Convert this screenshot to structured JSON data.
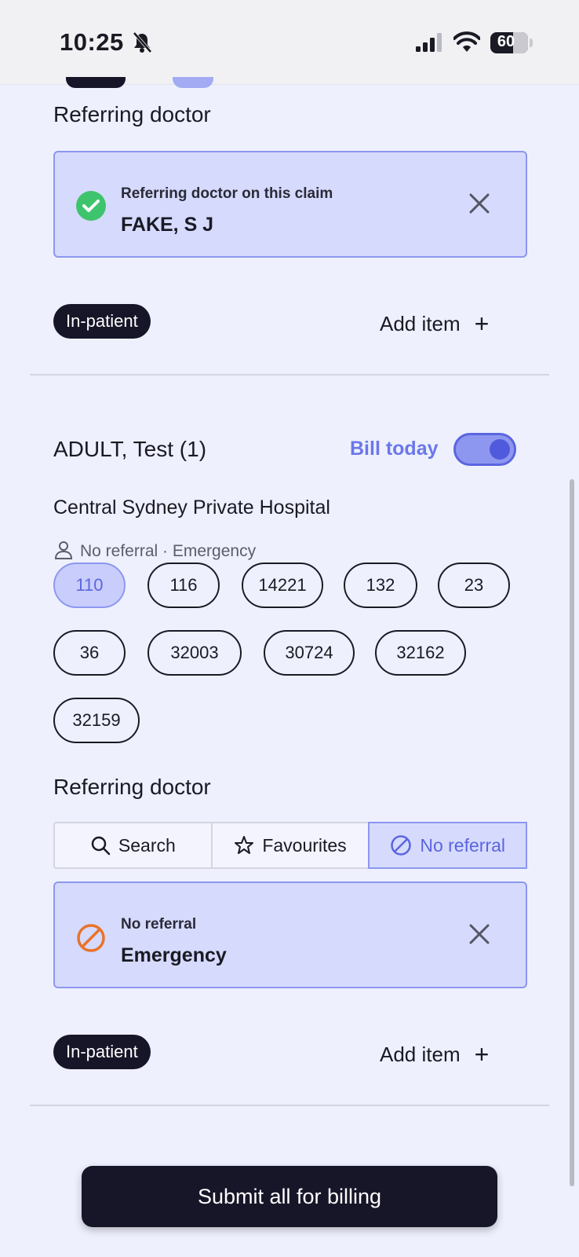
{
  "status_bar": {
    "time": "10:25",
    "battery": "60"
  },
  "claim1": {
    "section_title": "Referring doctor",
    "card": {
      "label": "Referring doctor on this claim",
      "value": "FAKE, S J"
    },
    "badge": "In-patient",
    "add_item": "Add item"
  },
  "claim2": {
    "patient_name": "ADULT, Test (1)",
    "bill_today_label": "Bill today",
    "bill_today_on": true,
    "hospital": "Central Sydney Private Hospital",
    "referral_summary": "No referral · Emergency",
    "codes": [
      "110",
      "116",
      "14221",
      "132",
      "23",
      "36",
      "32003",
      "30724",
      "32162",
      "32159"
    ],
    "selected_code": "110",
    "section_title": "Referring doctor",
    "tabs": [
      "Search",
      "Favourites",
      "No referral"
    ],
    "active_tab": "No referral",
    "card": {
      "label": "No referral",
      "value": "Emergency"
    },
    "badge": "In-patient",
    "add_item": "Add item"
  },
  "submit_label": "Submit all for billing",
  "colors": {
    "accent": "#6b77ea",
    "dark": "#171528",
    "success": "#3ec46d",
    "warning": "#e8732a"
  }
}
